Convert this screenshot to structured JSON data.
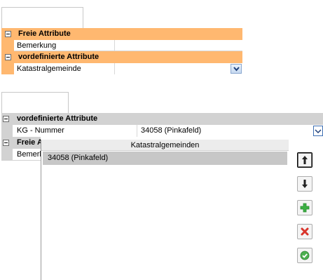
{
  "top_grid": {
    "category_1": "Freie Attribute",
    "property_1": "Bemerkung",
    "property_1_value": "",
    "category_2": "vordefinierte Attribute",
    "property_2": "Katastralgemeinde",
    "property_2_value": ""
  },
  "bottom_grid": {
    "category_1": "vordefinierte Attribute",
    "property_1": "KG - Nummer",
    "property_1_value": "34058 (Pinkafeld)",
    "category_2": "Freie A",
    "property_2": "Bemerk"
  },
  "popup": {
    "header": "Katastralgemeinden",
    "items": [
      "34058 (Pinkafeld)"
    ]
  },
  "buttons": [
    {
      "name": "move-up-button",
      "icon": "arrow-up-icon"
    },
    {
      "name": "move-down-button",
      "icon": "arrow-down-icon"
    },
    {
      "name": "add-button",
      "icon": "plus-icon"
    },
    {
      "name": "delete-button",
      "icon": "x-icon"
    },
    {
      "name": "confirm-button",
      "icon": "check-icon"
    }
  ],
  "colors": {
    "top_category": "#ffb870",
    "bottom_category": "#d2d2d2",
    "selection": "#c7c7c7",
    "add_green": "#3cb043",
    "delete_red": "#d9342b",
    "confirm_green": "#4caf50"
  }
}
